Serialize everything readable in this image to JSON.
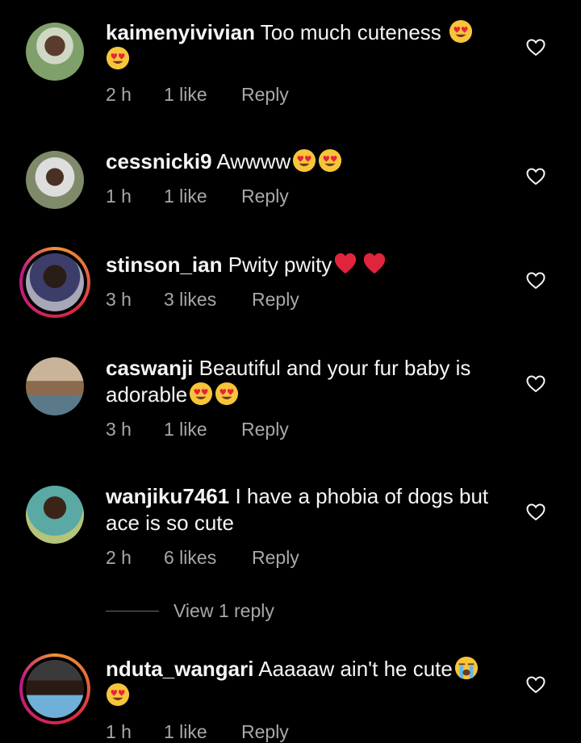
{
  "comments": [
    {
      "user": "kaimenyivivian",
      "text": "Too much cuteness",
      "time": "2 h",
      "likes": "1 like",
      "reply": "Reply"
    },
    {
      "user": "cessnicki9",
      "text": "Awwww",
      "time": "1 h",
      "likes": "1 like",
      "reply": "Reply"
    },
    {
      "user": "stinson_ian",
      "text": "Pwity pwity",
      "time": "3 h",
      "likes": "3 likes",
      "reply": "Reply"
    },
    {
      "user": "caswanji",
      "text": "Beautiful and your fur baby is adorable",
      "time": "3 h",
      "likes": "1 like",
      "reply": "Reply"
    },
    {
      "user": "wanjiku7461",
      "text": "I have a phobia of dogs but ace is so cute",
      "time": "2 h",
      "likes": "6 likes",
      "reply": "Reply"
    },
    {
      "user": "nduta_wangari",
      "text": "Aaaaaw ain't he cute",
      "time": "1 h",
      "likes": "1 like",
      "reply": "Reply"
    }
  ],
  "view_replies": "View 1 reply",
  "icons": {
    "heart": "heart-outline-icon",
    "heart_eyes": "heart-eyes-emoji",
    "red_heart": "red-heart-emoji",
    "crying": "loudly-crying-emoji"
  },
  "colors": {
    "background": "#000000",
    "text": "#f5f5f5",
    "secondary": "#a8a8a8",
    "story_ring": "#dc2743"
  }
}
